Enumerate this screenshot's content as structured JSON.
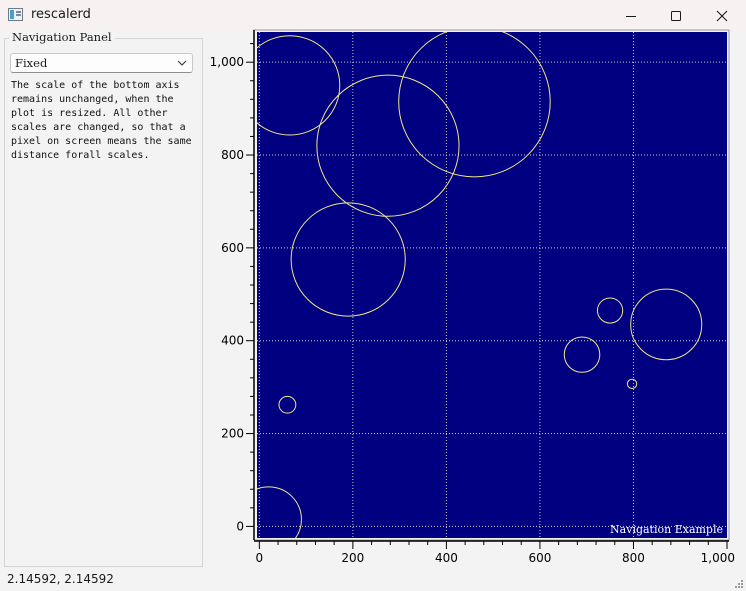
{
  "window": {
    "title": "rescalerd",
    "icon": "app-window-icon",
    "controls": [
      "minimize-icon",
      "maximize-icon",
      "close-icon"
    ]
  },
  "navigation_panel": {
    "title": "Navigation Panel",
    "mode_select": {
      "value": "Fixed"
    },
    "help_text": "The scale of the bottom axis\nremains unchanged, when the\nplot is resized. All other\nscales are changed, so that a\npixel on screen means the same\ndistance forall scales."
  },
  "plot": {
    "canvas_color": "#000080",
    "grid_color": "#c8c8c8",
    "circle_color": "#f0e68c",
    "watermark": "Navigation Example",
    "grid": true,
    "x_ticks": [
      "0",
      "200",
      "400",
      "600",
      "800",
      "1,000"
    ],
    "y_ticks": [
      "0",
      "200",
      "400",
      "600",
      "800",
      "1,000"
    ]
  },
  "chart_data": {
    "type": "scatter",
    "title": "",
    "xlabel": "",
    "ylabel": "",
    "xlim": [
      -5,
      1000
    ],
    "ylim": [
      -25,
      1065
    ],
    "circles": [
      {
        "x": 65,
        "y": 950,
        "r": 107
      },
      {
        "x": 275,
        "y": 820,
        "r": 152
      },
      {
        "x": 460,
        "y": 915,
        "r": 162
      },
      {
        "x": 190,
        "y": 575,
        "r": 122
      },
      {
        "x": 60,
        "y": 262,
        "r": 18
      },
      {
        "x": 20,
        "y": 15,
        "r": 70
      },
      {
        "x": 690,
        "y": 370,
        "r": 38
      },
      {
        "x": 750,
        "y": 465,
        "r": 27
      },
      {
        "x": 870,
        "y": 435,
        "r": 76
      },
      {
        "x": 797,
        "y": 307,
        "r": 10
      }
    ]
  },
  "status_bar": {
    "coordinates": "2.14592, 2.14592"
  }
}
